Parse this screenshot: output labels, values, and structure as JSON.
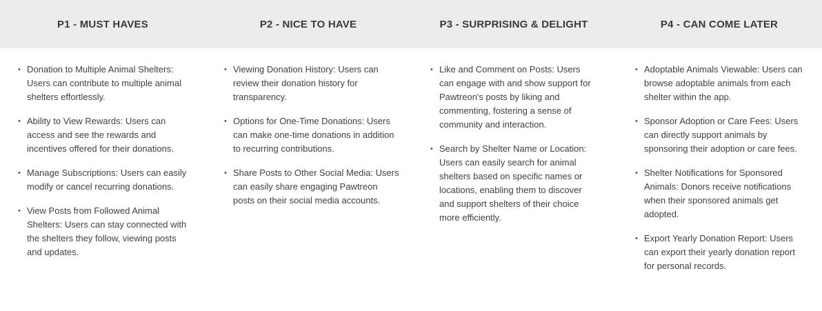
{
  "columns": [
    {
      "title": "P1 - MUST HAVES",
      "items": [
        "Donation to Multiple Animal Shelters: Users can contribute to multiple animal shelters effortlessly.",
        "Ability to View Rewards: Users can access and see the rewards and incentives offered for their donations.",
        "Manage Subscriptions: Users can easily modify or cancel recurring donations.",
        "View Posts from Followed Animal Shelters: Users can stay connected with the shelters they follow, viewing posts and updates."
      ]
    },
    {
      "title": "P2 - NICE TO HAVE",
      "items": [
        "Viewing Donation History: Users can review their donation history for transparency.",
        "Options for One-Time Donations: Users can make one-time donations in addition to recurring contributions.",
        "Share Posts to Other Social Media: Users can easily share engaging Pawtreon posts on their social media accounts."
      ]
    },
    {
      "title": "P3 - SURPRISING & DELIGHT",
      "items": [
        "Like and Comment on Posts: Users can engage with and show support for Pawtreon's posts by liking and commenting, fostering a sense of community and interaction.",
        "Search by Shelter Name or Location: Users can easily search for animal shelters based on specific names or locations, enabling them to discover and support shelters of their choice more efficiently."
      ]
    },
    {
      "title": "P4 - CAN COME LATER",
      "items": [
        "Adoptable Animals Viewable: Users can browse adoptable animals from each shelter within the app.",
        "Sponsor Adoption or Care Fees: Users can directly support animals by sponsoring their adoption or care fees.",
        "Shelter Notifications for Sponsored Animals: Donors receive notifications when their sponsored animals get adopted.",
        "Export Yearly Donation Report: Users can export their yearly donation report for personal records."
      ]
    }
  ],
  "colors": {
    "header_background": "#ececec",
    "header_text": "#3a3a3a",
    "body_text": "#3f3f3f",
    "background": "#ffffff"
  }
}
